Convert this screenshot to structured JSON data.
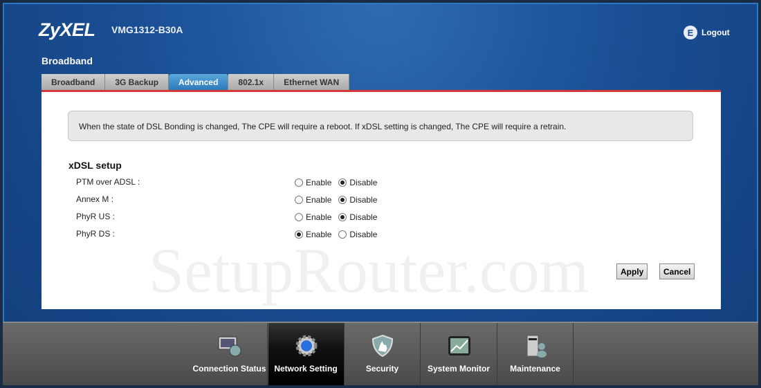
{
  "header": {
    "brand": "ZyXEL",
    "model": "VMG1312-B30A",
    "logout": "Logout"
  },
  "section_title": "Broadband",
  "tabs": [
    {
      "label": "Broadband"
    },
    {
      "label": "3G Backup"
    },
    {
      "label": "Advanced",
      "active": true
    },
    {
      "label": "802.1x"
    },
    {
      "label": "Ethernet WAN"
    }
  ],
  "notice": "When the state of DSL Bonding is changed, The CPE will require a reboot. If xDSL setting is changed, The CPE will require a retrain.",
  "xdsl": {
    "title": "xDSL setup",
    "enable_label": "Enable",
    "disable_label": "Disable",
    "rows": [
      {
        "label": "PTM over ADSL :",
        "value": "Disable"
      },
      {
        "label": "Annex M :",
        "value": "Disable"
      },
      {
        "label": "PhyR US :",
        "value": "Disable"
      },
      {
        "label": "PhyR DS :",
        "value": "Enable"
      }
    ]
  },
  "buttons": {
    "apply": "Apply",
    "cancel": "Cancel"
  },
  "watermark": "SetupRouter.com",
  "nav": [
    {
      "label": "Connection Status",
      "icon": "monitor-globe-icon"
    },
    {
      "label": "Network Setting",
      "icon": "gear-icon",
      "active": true
    },
    {
      "label": "Security",
      "icon": "shield-icon"
    },
    {
      "label": "System Monitor",
      "icon": "chart-icon"
    },
    {
      "label": "Maintenance",
      "icon": "maintenance-icon"
    }
  ],
  "colors": {
    "accent": "#2a78b8",
    "tab_line": "#d23a3a",
    "background": "#1a4f94"
  }
}
